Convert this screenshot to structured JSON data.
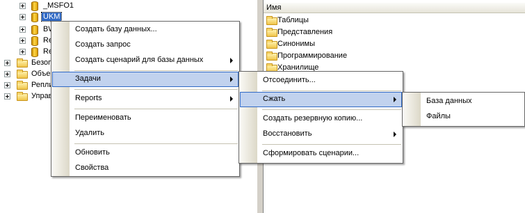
{
  "tree": {
    "nodes": [
      {
        "label": "_MSFO1",
        "icon": "database-icon"
      },
      {
        "label": "UKM",
        "icon": "database-icon"
      },
      {
        "label": "BW",
        "icon": "database-icon"
      },
      {
        "label": "Re",
        "icon": "database-icon"
      },
      {
        "label": "Re",
        "icon": "database-icon"
      },
      {
        "label": "Безоп",
        "icon": "folder-icon"
      },
      {
        "label": "Объек",
        "icon": "folder-icon"
      },
      {
        "label": "Репли",
        "icon": "folder-icon"
      },
      {
        "label": "Управ",
        "icon": "folder-icon"
      }
    ]
  },
  "details": {
    "column_header": "Имя",
    "items": [
      "Таблицы",
      "Представления",
      "Синонимы",
      "Программирование",
      "Хранилище"
    ]
  },
  "context_menu": {
    "items": [
      {
        "label": "Создать базу данных..."
      },
      {
        "label": "Создать запрос"
      },
      {
        "label": "Создать сценарий для базы данных"
      },
      {
        "label": "Задачи"
      },
      {
        "label": "Reports"
      },
      {
        "label": "Переименовать"
      },
      {
        "label": "Удалить"
      },
      {
        "label": "Обновить"
      },
      {
        "label": "Свойства"
      }
    ]
  },
  "tasks_menu": {
    "items": [
      {
        "label": "Отсоединить..."
      },
      {
        "label": "Сжать"
      },
      {
        "label": "Создать резервную копию..."
      },
      {
        "label": "Восстановить"
      },
      {
        "label": "Сформировать сценарии..."
      }
    ]
  },
  "shrink_menu": {
    "items": [
      {
        "label": "База данных"
      },
      {
        "label": "Файлы"
      }
    ]
  },
  "colors": {
    "highlight_bg": "#c1d2ee",
    "highlight_border": "#316ac5",
    "selection": "#316ac5"
  }
}
